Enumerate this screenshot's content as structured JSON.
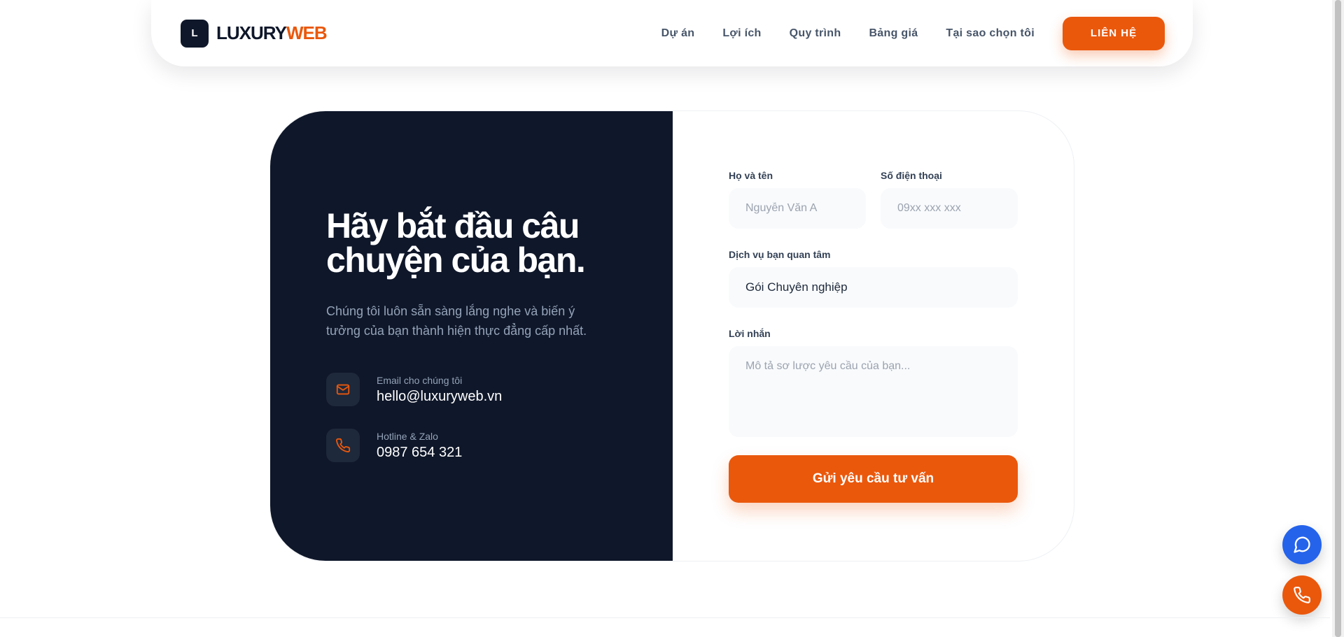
{
  "brand": {
    "mark": "L",
    "name_part1": "LUXURY",
    "name_part2": "WEB",
    "accent": "#ea580c",
    "dark": "#0f172a"
  },
  "nav": {
    "items": [
      {
        "label": "Dự án"
      },
      {
        "label": "Lợi ích"
      },
      {
        "label": "Quy trình"
      },
      {
        "label": "Bảng giá"
      },
      {
        "label": "Tại sao chọn tôi"
      }
    ],
    "cta_label": "LIÊN HỆ"
  },
  "contact": {
    "headline_line1": "Hãy bắt đầu câu",
    "headline_line2": "chuyện của bạn.",
    "subtitle": "Chúng tôi luôn sẵn sàng lắng nghe và biến ý tưởng của bạn thành hiện thực đẳng cấp nhất.",
    "email": {
      "icon": "mail-icon",
      "label": "Email cho chúng tôi",
      "value": "hello@luxuryweb.vn"
    },
    "phone": {
      "icon": "phone-icon",
      "label": "Hotline & Zalo",
      "value": "0987 654 321"
    }
  },
  "form": {
    "name": {
      "label": "Họ và tên",
      "placeholder": "Nguyễn Văn A"
    },
    "phone": {
      "label": "Số điện thoại",
      "placeholder": "09xx xxx xxx"
    },
    "service": {
      "label": "Dịch vụ bạn quan tâm",
      "value": "Gói Chuyên nghiệp"
    },
    "message": {
      "label": "Lời nhắn",
      "placeholder": "Mô tả sơ lược yêu cầu của bạn..."
    },
    "submit_label": "Gửi yêu cầu tư vấn"
  },
  "floating": {
    "chat_icon": "chat-icon",
    "chat_color": "#2563eb",
    "phone_icon": "phone-icon",
    "phone_color": "#ea580c"
  }
}
